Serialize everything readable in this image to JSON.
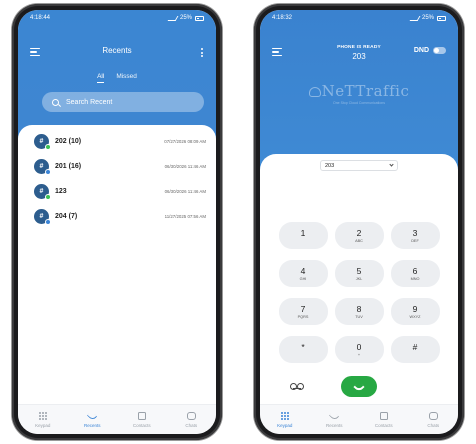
{
  "left_phone": {
    "status": {
      "time": "4:18:44",
      "battery": "25%"
    },
    "header": {
      "title": "Recents"
    },
    "filters": [
      {
        "label": "All",
        "active": true
      },
      {
        "label": "Missed",
        "active": false
      }
    ],
    "search": {
      "placeholder": "Search Recent"
    },
    "recents": [
      {
        "avatar": "#",
        "name": "202 (10)",
        "time": "07/27/2026 08:09 AM",
        "badge": "green"
      },
      {
        "avatar": "#",
        "name": "201 (16)",
        "time": "06/30/2026 11:46 AM",
        "badge": "blue"
      },
      {
        "avatar": "#",
        "name": "123",
        "time": "06/30/2026 11:46 AM",
        "badge": "green"
      },
      {
        "avatar": "#",
        "name": "204 (7)",
        "time": "11/27/2025 07:56 AM",
        "badge": "blue"
      }
    ],
    "nav": [
      {
        "label": "Keypad",
        "icon": "keypad-icon",
        "active": false
      },
      {
        "label": "Recents",
        "icon": "recents-icon",
        "active": true
      },
      {
        "label": "Contacts",
        "icon": "contacts-icon",
        "active": false
      },
      {
        "label": "Chats",
        "icon": "chats-icon",
        "active": false
      }
    ]
  },
  "right_phone": {
    "status": {
      "time": "4:18:32",
      "battery": "25%"
    },
    "header": {
      "status_text": "PHONE IS READY",
      "extension": "203",
      "dnd_label": "DND",
      "dnd_on": false
    },
    "logo": {
      "text": "NeTTraffic",
      "tagline": "One Stop Cloud Communications"
    },
    "selected_extension": "203",
    "keys": [
      {
        "digit": "1",
        "letters": ""
      },
      {
        "digit": "2",
        "letters": "ABC"
      },
      {
        "digit": "3",
        "letters": "DEF"
      },
      {
        "digit": "4",
        "letters": "GHI"
      },
      {
        "digit": "5",
        "letters": "JKL"
      },
      {
        "digit": "6",
        "letters": "MNO"
      },
      {
        "digit": "7",
        "letters": "PQRS"
      },
      {
        "digit": "8",
        "letters": "TUV"
      },
      {
        "digit": "9",
        "letters": "WXYZ"
      },
      {
        "digit": "*",
        "letters": ""
      },
      {
        "digit": "0",
        "letters": "+"
      },
      {
        "digit": "#",
        "letters": ""
      }
    ],
    "nav": [
      {
        "label": "Keypad",
        "icon": "keypad-icon",
        "active": true
      },
      {
        "label": "Recents",
        "icon": "recents-icon",
        "active": false
      },
      {
        "label": "Contacts",
        "icon": "contacts-icon",
        "active": false
      },
      {
        "label": "Chats",
        "icon": "chats-icon",
        "active": false
      }
    ]
  },
  "colors": {
    "primary": "#3b86d2",
    "call_green": "#27a843",
    "avatar": "#2d5d8e",
    "badge_green": "#3cbf54",
    "badge_blue": "#3a84d6"
  }
}
